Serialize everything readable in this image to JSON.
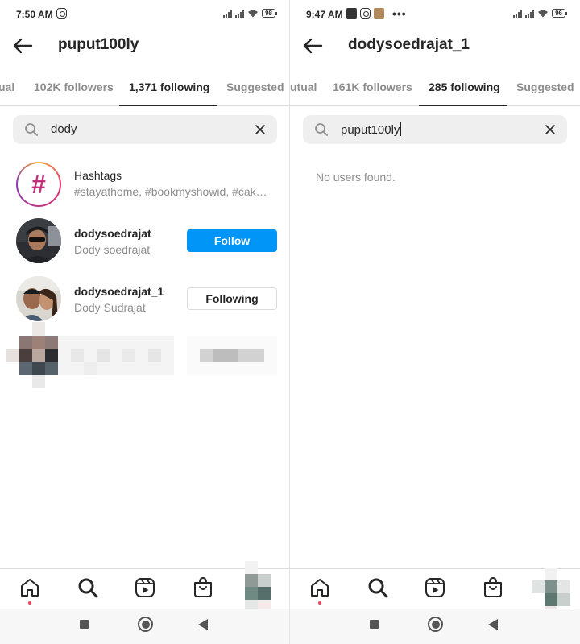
{
  "left": {
    "status": {
      "time": "7:50 AM",
      "battery": "98"
    },
    "header": {
      "title": "puput100ly"
    },
    "tabs": [
      {
        "label": "ual"
      },
      {
        "label": "102K followers"
      },
      {
        "label": "1,371 following",
        "active": true
      },
      {
        "label": "Suggested"
      }
    ],
    "search": {
      "value": "dody"
    },
    "results": [
      {
        "type": "hashtag",
        "title": "Hashtags",
        "subtitle": "#stayathome, #bookmyshowid, #cak…"
      },
      {
        "type": "user",
        "username": "dodysoedrajat",
        "fullname": "Dody soedrajat",
        "button": "Follow"
      },
      {
        "type": "user",
        "username": "dodysoedrajat_1",
        "fullname": "Dody Sudrajat",
        "button": "Following"
      }
    ]
  },
  "right": {
    "status": {
      "time": "9:47 AM",
      "battery": "96"
    },
    "header": {
      "title": "dodysoedrajat_1"
    },
    "tabs": [
      {
        "label": "utual"
      },
      {
        "label": "161K followers"
      },
      {
        "label": "285 following",
        "active": true
      },
      {
        "label": "Suggested"
      }
    ],
    "search": {
      "value": "puput100ly"
    },
    "empty_message": "No users found."
  },
  "nav_icons": [
    "home-icon",
    "search-icon",
    "reels-icon",
    "shop-icon",
    "profile-avatar"
  ],
  "colors": {
    "follow_blue": "#0095f6",
    "notification_red": "#ed4956",
    "muted_text": "#8e8e8e"
  }
}
